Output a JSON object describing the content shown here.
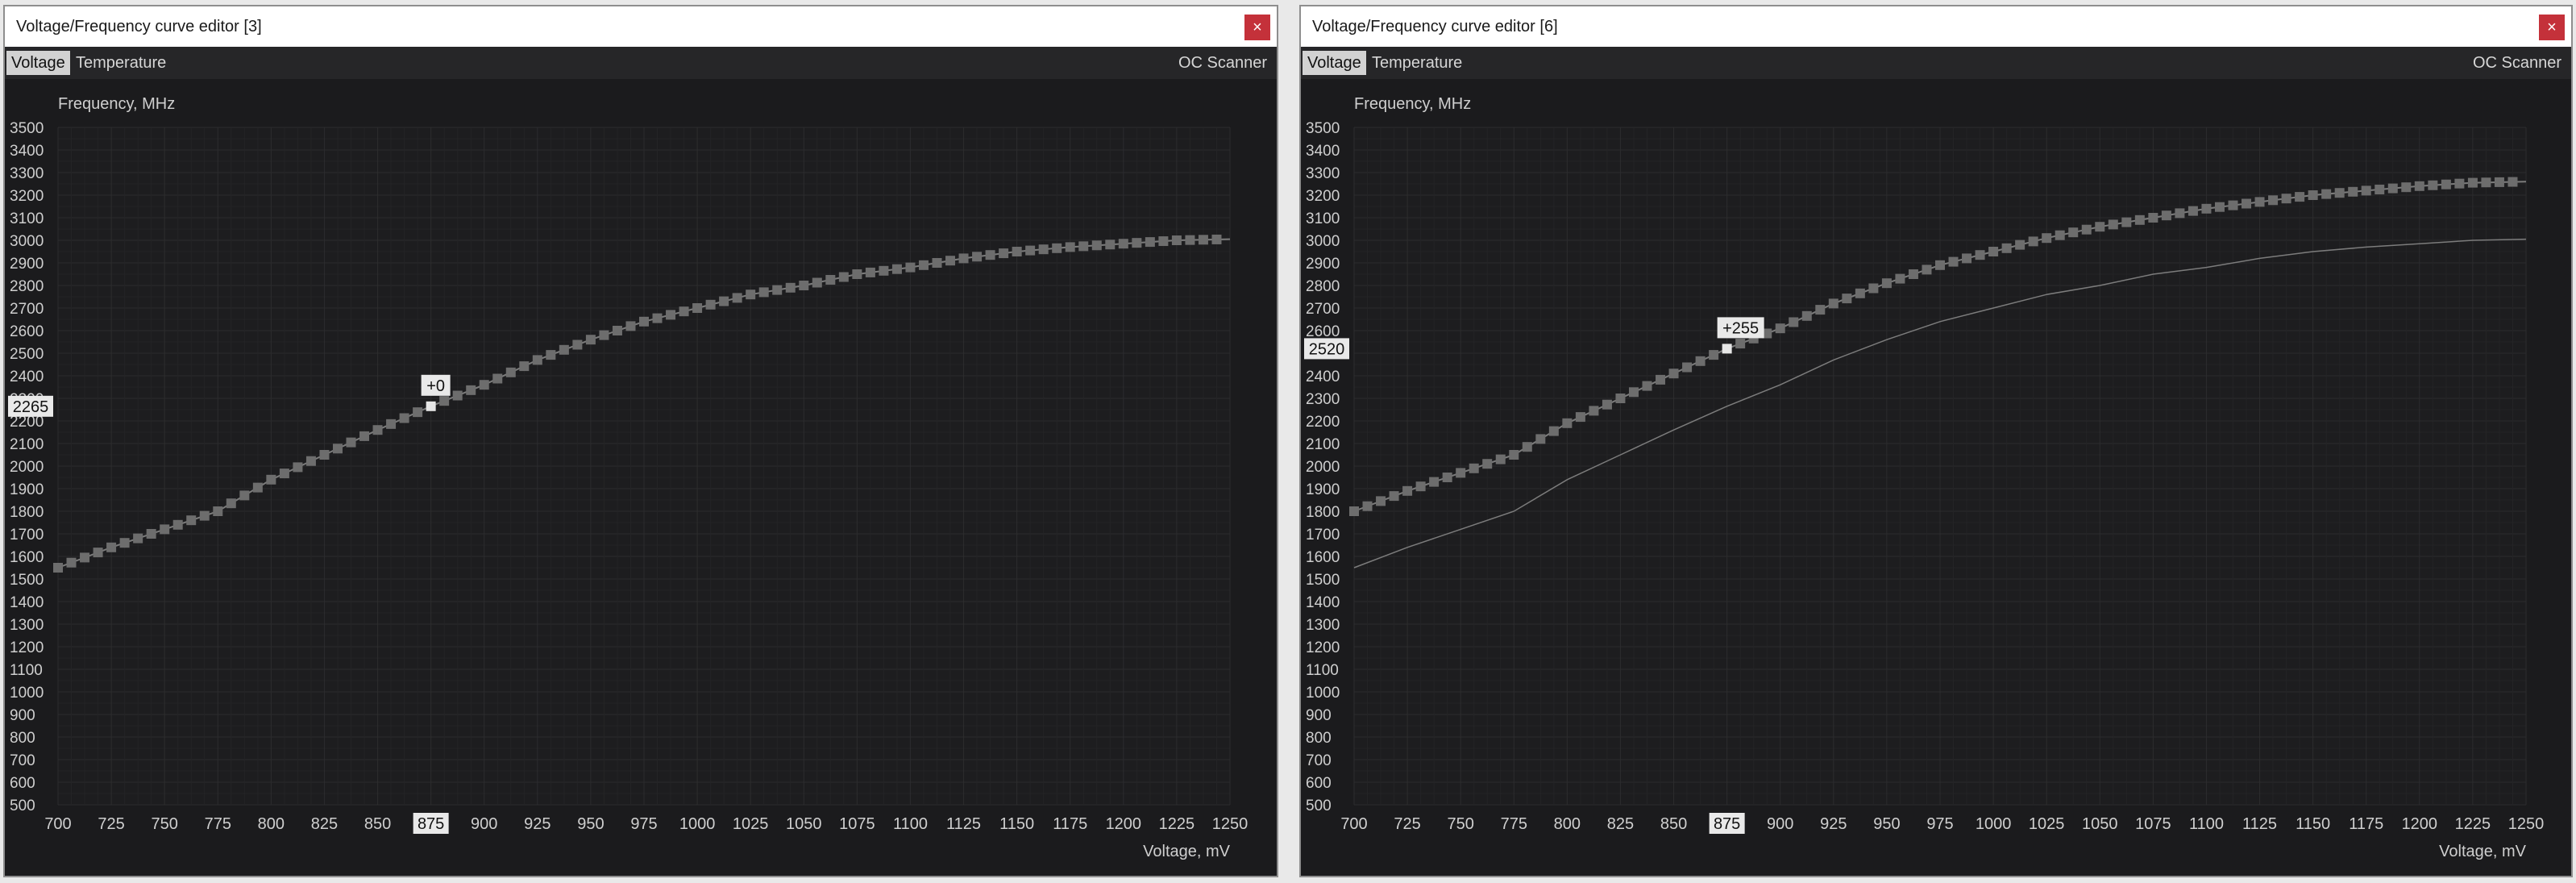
{
  "windows": [
    {
      "title": "Voltage/Frequency curve editor [3]",
      "close_label": "×",
      "tabs": {
        "voltage": "Voltage",
        "temperature": "Temperature",
        "oc_scanner": "OC Scanner"
      },
      "y_axis_label": "Frequency, MHz",
      "x_axis_label": "Voltage, mV",
      "y_ticks": [
        "3500",
        "3400",
        "3300",
        "3200",
        "3100",
        "3000",
        "2900",
        "2800",
        "2700",
        "2600",
        "2500",
        "2400",
        "2300",
        "2200",
        "2100",
        "2000",
        "1900",
        "1800",
        "1700",
        "1600",
        "1500",
        "1400",
        "1300",
        "1200",
        "1100",
        "1000",
        "900",
        "800",
        "700",
        "600",
        "500"
      ],
      "x_ticks": [
        "700",
        "725",
        "750",
        "775",
        "800",
        "825",
        "850",
        "875",
        "900",
        "925",
        "950",
        "975",
        "1000",
        "1025",
        "1050",
        "1075",
        "1100",
        "1125",
        "1150",
        "1175",
        "1200",
        "1225",
        "1250"
      ],
      "selected_point": {
        "voltage": "875",
        "frequency": "2265",
        "offset": "+0"
      }
    },
    {
      "title": "Voltage/Frequency curve editor [6]",
      "close_label": "×",
      "tabs": {
        "voltage": "Voltage",
        "temperature": "Temperature",
        "oc_scanner": "OC Scanner"
      },
      "y_axis_label": "Frequency, MHz",
      "x_axis_label": "Voltage, mV",
      "y_ticks": [
        "3500",
        "3400",
        "3300",
        "3200",
        "3100",
        "3000",
        "2900",
        "2800",
        "2700",
        "2600",
        "2500",
        "2400",
        "2300",
        "2200",
        "2100",
        "2000",
        "1900",
        "1800",
        "1700",
        "1600",
        "1500",
        "1400",
        "1300",
        "1200",
        "1100",
        "1000",
        "900",
        "800",
        "700",
        "600",
        "500"
      ],
      "x_ticks": [
        "700",
        "725",
        "750",
        "775",
        "800",
        "825",
        "850",
        "875",
        "900",
        "925",
        "950",
        "975",
        "1000",
        "1025",
        "1050",
        "1075",
        "1100",
        "1125",
        "1150",
        "1175",
        "1200",
        "1225",
        "1250"
      ],
      "selected_point": {
        "voltage": "875",
        "frequency": "2520",
        "offset": "+255"
      }
    }
  ],
  "chart_data": [
    {
      "type": "line",
      "xlabel": "Voltage, mV",
      "ylabel": "Frequency, MHz",
      "xlim": [
        700,
        1250
      ],
      "ylim": [
        500,
        3500
      ],
      "grid": true,
      "x": [
        700,
        725,
        750,
        775,
        800,
        825,
        850,
        875,
        900,
        925,
        950,
        975,
        1000,
        1025,
        1050,
        1075,
        1100,
        1125,
        1150,
        1175,
        1200,
        1225,
        1250
      ],
      "series": [
        {
          "values": [
            1550,
            1640,
            1720,
            1800,
            1940,
            2050,
            2160,
            2265,
            2360,
            2470,
            2560,
            2640,
            2700,
            2760,
            2800,
            2850,
            2880,
            2920,
            2950,
            2970,
            2985,
            3000,
            3005
          ]
        }
      ],
      "colors": {
        "curve": "#7c7c7c",
        "marker": "#6d6d6d",
        "selected_marker": "#e6e6e6"
      }
    },
    {
      "type": "line",
      "xlabel": "Voltage, mV",
      "ylabel": "Frequency, MHz",
      "xlim": [
        700,
        1250
      ],
      "ylim": [
        500,
        3500
      ],
      "grid": true,
      "x": [
        700,
        725,
        750,
        775,
        800,
        825,
        850,
        875,
        900,
        925,
        950,
        975,
        1000,
        1025,
        1050,
        1075,
        1100,
        1125,
        1150,
        1175,
        1200,
        1225,
        1250
      ],
      "series": [
        {
          "values": [
            1800,
            1890,
            1970,
            2050,
            2190,
            2300,
            2410,
            2520,
            2610,
            2720,
            2810,
            2890,
            2950,
            3010,
            3060,
            3100,
            3140,
            3170,
            3200,
            3220,
            3240,
            3255,
            3260
          ]
        },
        {
          "values": [
            1550,
            1640,
            1720,
            1800,
            1940,
            2050,
            2160,
            2265,
            2360,
            2470,
            2560,
            2640,
            2700,
            2760,
            2800,
            2850,
            2880,
            2920,
            2950,
            2970,
            2985,
            3000,
            3005
          ]
        }
      ],
      "colors": {
        "curve": "#7c7c7c",
        "marker": "#6d6d6d",
        "selected_marker": "#e6e6e6"
      }
    }
  ]
}
